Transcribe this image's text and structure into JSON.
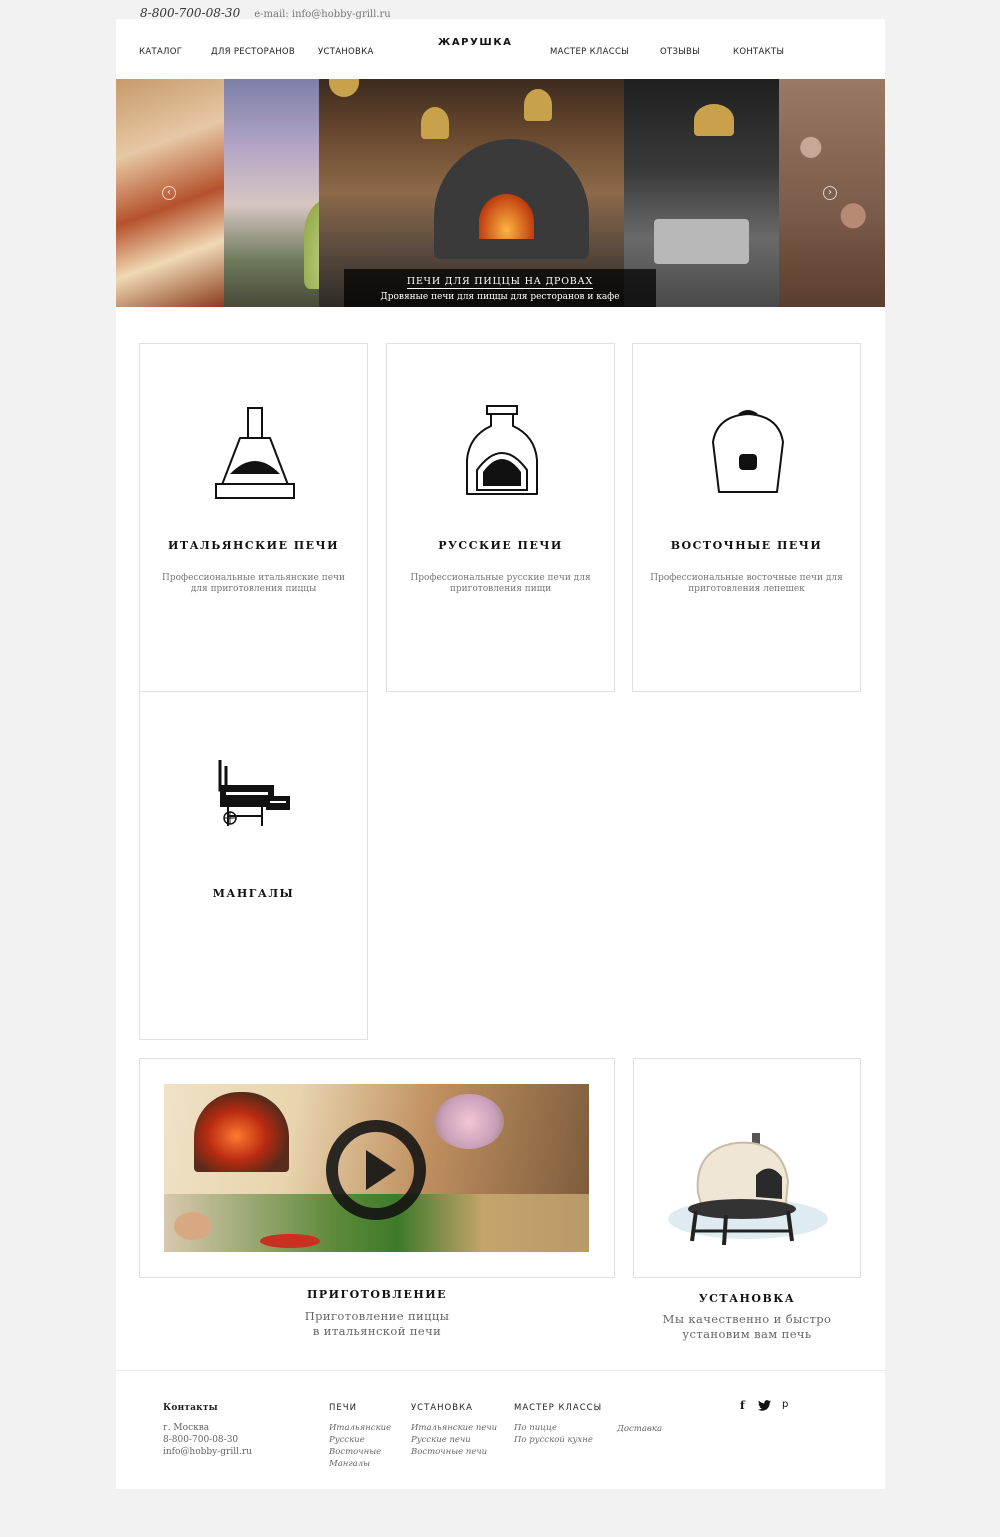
{
  "topbar": {
    "phone": "8-800-700-08-30",
    "email": "e-mail: info@hobby-grill.ru"
  },
  "header": {
    "logo": "ЖАРУШКА",
    "nav": [
      "КАТАЛОГ",
      "ДЛЯ РЕСТОРАНОВ",
      "УСТАНОВКА",
      "МАСТЕР КЛАССЫ",
      "ОТЗЫВЫ",
      "КОНТАКТЫ"
    ]
  },
  "hero": {
    "title": "ПЕЧИ ДЛЯ ПИЦЦЫ НА ДРОВАХ",
    "subtitle": "Дровяные печи для пиццы для ресторанов и кафе",
    "prev_icon": "chevron-left-icon",
    "next_icon": "chevron-right-icon"
  },
  "catalog": [
    {
      "title": "ИТАЛЬЯНСКИЕ ПЕЧИ",
      "desc": "Профессиональные итальянские печи для приготовления пиццы",
      "icon": "italian-oven-icon"
    },
    {
      "title": "РУССКИЕ ПЕЧИ",
      "desc": "Профессиональные русские печи для приготовления пищи",
      "icon": "russian-oven-icon"
    },
    {
      "title": "ВОСТОЧНЫЕ ПЕЧИ",
      "desc": "Профессиональные восточные печи для приготовления лепешек",
      "icon": "tandoor-icon"
    },
    {
      "title": "МАНГАЛЫ",
      "desc": "",
      "icon": "grill-icon"
    }
  ],
  "video": {
    "title": "ПРИГОТОВЛЕНИЕ",
    "desc_line1": "Приготовление пиццы",
    "desc_line2": "в итальянской печи",
    "icon": "play-icon"
  },
  "install": {
    "title": "УСТАНОВКА",
    "desc_line1": "Мы качественно и быстро",
    "desc_line2": "установим вам печь"
  },
  "footer": {
    "contacts": {
      "heading": "Контакты",
      "city": "г. Москва",
      "phone": "8-800-700-08-30",
      "email": "info@hobby-grill.ru"
    },
    "ovens": {
      "heading": "ПЕЧИ",
      "links": [
        "Итальянские",
        "Русские",
        "Восточные",
        "Мангалы"
      ]
    },
    "install": {
      "heading": "УСТАНОВКА",
      "links": [
        "Итальянские печи",
        "Русские печи",
        "Восточные печи"
      ]
    },
    "classes": {
      "heading": "МАСТЕР КЛАССЫ",
      "links": [
        "По пицце",
        "По русской кухне"
      ]
    },
    "delivery": "Доставка",
    "social": {
      "facebook": "f",
      "twitter_icon": "twitter-icon",
      "pinterest": "p"
    }
  }
}
